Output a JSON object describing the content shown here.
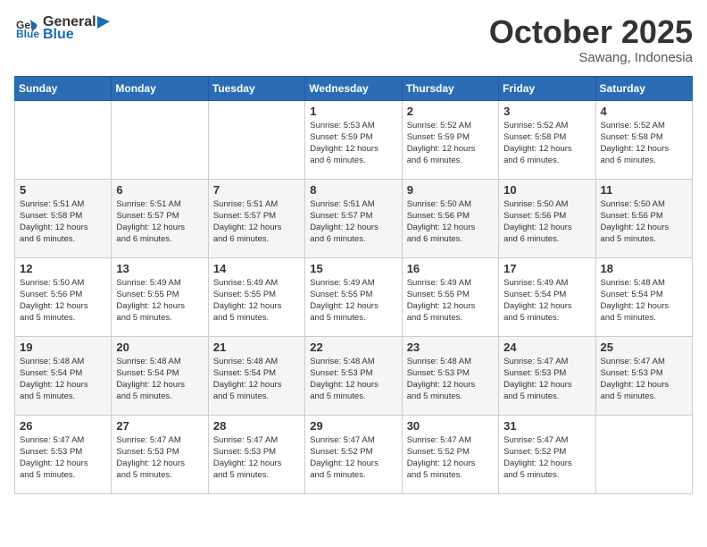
{
  "logo": {
    "general": "General",
    "blue": "Blue"
  },
  "title": "October 2025",
  "location": "Sawang, Indonesia",
  "days": [
    "Sunday",
    "Monday",
    "Tuesday",
    "Wednesday",
    "Thursday",
    "Friday",
    "Saturday"
  ],
  "weeks": [
    [
      {
        "day": "",
        "text": ""
      },
      {
        "day": "",
        "text": ""
      },
      {
        "day": "",
        "text": ""
      },
      {
        "day": "1",
        "text": "Sunrise: 5:53 AM\nSunset: 5:59 PM\nDaylight: 12 hours\nand 6 minutes."
      },
      {
        "day": "2",
        "text": "Sunrise: 5:52 AM\nSunset: 5:59 PM\nDaylight: 12 hours\nand 6 minutes."
      },
      {
        "day": "3",
        "text": "Sunrise: 5:52 AM\nSunset: 5:58 PM\nDaylight: 12 hours\nand 6 minutes."
      },
      {
        "day": "4",
        "text": "Sunrise: 5:52 AM\nSunset: 5:58 PM\nDaylight: 12 hours\nand 6 minutes."
      }
    ],
    [
      {
        "day": "5",
        "text": "Sunrise: 5:51 AM\nSunset: 5:58 PM\nDaylight: 12 hours\nand 6 minutes."
      },
      {
        "day": "6",
        "text": "Sunrise: 5:51 AM\nSunset: 5:57 PM\nDaylight: 12 hours\nand 6 minutes."
      },
      {
        "day": "7",
        "text": "Sunrise: 5:51 AM\nSunset: 5:57 PM\nDaylight: 12 hours\nand 6 minutes."
      },
      {
        "day": "8",
        "text": "Sunrise: 5:51 AM\nSunset: 5:57 PM\nDaylight: 12 hours\nand 6 minutes."
      },
      {
        "day": "9",
        "text": "Sunrise: 5:50 AM\nSunset: 5:56 PM\nDaylight: 12 hours\nand 6 minutes."
      },
      {
        "day": "10",
        "text": "Sunrise: 5:50 AM\nSunset: 5:56 PM\nDaylight: 12 hours\nand 6 minutes."
      },
      {
        "day": "11",
        "text": "Sunrise: 5:50 AM\nSunset: 5:56 PM\nDaylight: 12 hours\nand 5 minutes."
      }
    ],
    [
      {
        "day": "12",
        "text": "Sunrise: 5:50 AM\nSunset: 5:56 PM\nDaylight: 12 hours\nand 5 minutes."
      },
      {
        "day": "13",
        "text": "Sunrise: 5:49 AM\nSunset: 5:55 PM\nDaylight: 12 hours\nand 5 minutes."
      },
      {
        "day": "14",
        "text": "Sunrise: 5:49 AM\nSunset: 5:55 PM\nDaylight: 12 hours\nand 5 minutes."
      },
      {
        "day": "15",
        "text": "Sunrise: 5:49 AM\nSunset: 5:55 PM\nDaylight: 12 hours\nand 5 minutes."
      },
      {
        "day": "16",
        "text": "Sunrise: 5:49 AM\nSunset: 5:55 PM\nDaylight: 12 hours\nand 5 minutes."
      },
      {
        "day": "17",
        "text": "Sunrise: 5:49 AM\nSunset: 5:54 PM\nDaylight: 12 hours\nand 5 minutes."
      },
      {
        "day": "18",
        "text": "Sunrise: 5:48 AM\nSunset: 5:54 PM\nDaylight: 12 hours\nand 5 minutes."
      }
    ],
    [
      {
        "day": "19",
        "text": "Sunrise: 5:48 AM\nSunset: 5:54 PM\nDaylight: 12 hours\nand 5 minutes."
      },
      {
        "day": "20",
        "text": "Sunrise: 5:48 AM\nSunset: 5:54 PM\nDaylight: 12 hours\nand 5 minutes."
      },
      {
        "day": "21",
        "text": "Sunrise: 5:48 AM\nSunset: 5:54 PM\nDaylight: 12 hours\nand 5 minutes."
      },
      {
        "day": "22",
        "text": "Sunrise: 5:48 AM\nSunset: 5:53 PM\nDaylight: 12 hours\nand 5 minutes."
      },
      {
        "day": "23",
        "text": "Sunrise: 5:48 AM\nSunset: 5:53 PM\nDaylight: 12 hours\nand 5 minutes."
      },
      {
        "day": "24",
        "text": "Sunrise: 5:47 AM\nSunset: 5:53 PM\nDaylight: 12 hours\nand 5 minutes."
      },
      {
        "day": "25",
        "text": "Sunrise: 5:47 AM\nSunset: 5:53 PM\nDaylight: 12 hours\nand 5 minutes."
      }
    ],
    [
      {
        "day": "26",
        "text": "Sunrise: 5:47 AM\nSunset: 5:53 PM\nDaylight: 12 hours\nand 5 minutes."
      },
      {
        "day": "27",
        "text": "Sunrise: 5:47 AM\nSunset: 5:53 PM\nDaylight: 12 hours\nand 5 minutes."
      },
      {
        "day": "28",
        "text": "Sunrise: 5:47 AM\nSunset: 5:53 PM\nDaylight: 12 hours\nand 5 minutes."
      },
      {
        "day": "29",
        "text": "Sunrise: 5:47 AM\nSunset: 5:52 PM\nDaylight: 12 hours\nand 5 minutes."
      },
      {
        "day": "30",
        "text": "Sunrise: 5:47 AM\nSunset: 5:52 PM\nDaylight: 12 hours\nand 5 minutes."
      },
      {
        "day": "31",
        "text": "Sunrise: 5:47 AM\nSunset: 5:52 PM\nDaylight: 12 hours\nand 5 minutes."
      },
      {
        "day": "",
        "text": ""
      }
    ]
  ]
}
